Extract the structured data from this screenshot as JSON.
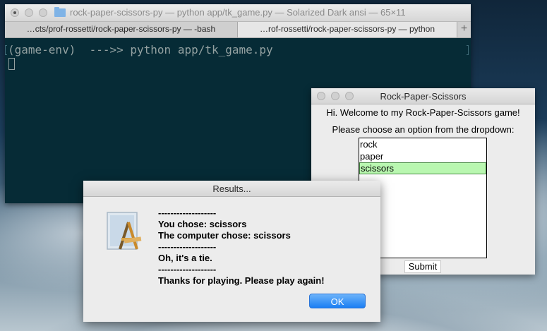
{
  "terminal": {
    "title": "rock-paper-scissors-py — python app/tk_game.py — Solarized Dark ansi — 65×11",
    "tabs": [
      {
        "label": "…cts/prof-rossetti/rock-paper-scissors-py — -bash"
      },
      {
        "label": "…rof-rossetti/rock-paper-scissors-py — python"
      }
    ],
    "add_tab_label": "+",
    "command_line": "(game-env)  --->> python app/tk_game.py"
  },
  "rps_window": {
    "title": "Rock-Paper-Scissors",
    "welcome": "Hi. Welcome to my Rock-Paper-Scissors game!",
    "prompt": "Please choose an option from the dropdown:",
    "options": [
      "rock",
      "paper",
      "scissors"
    ],
    "selected": "scissors",
    "submit_label": "Submit"
  },
  "results_dialog": {
    "title": "Results...",
    "lines": [
      "-------------------",
      "You chose: scissors",
      "The computer chose: scissors",
      "-------------------",
      "Oh, it's a tie.",
      "-------------------",
      "Thanks for playing. Please play again!"
    ],
    "ok_label": "OK"
  },
  "colors": {
    "terminal_bg": "#062b36",
    "terminal_text": "#93a1a1",
    "selection": "#b9f7b0",
    "ok_button": "#1b7ef3"
  }
}
